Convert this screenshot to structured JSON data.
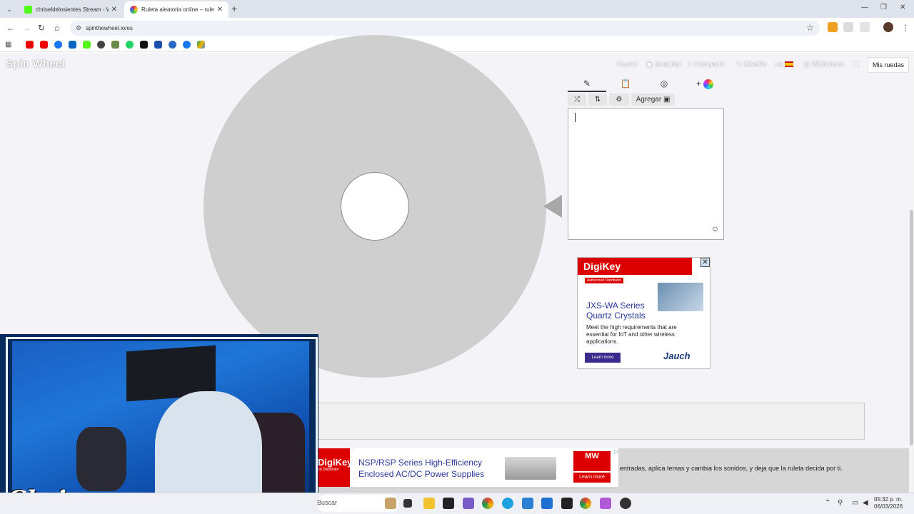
{
  "browser": {
    "tabs": [
      {
        "title": "chriseldelosientes Stream - Wat",
        "favicon_color": "#53fc18",
        "active": false
      },
      {
        "title": "Ruleta aleatoria online – ruleta",
        "favicon_color": "#f4a300",
        "active": true
      }
    ],
    "url_host": "spinthewheel.io",
    "url_path": "/es"
  },
  "page": {
    "logo": "Spin Wheel",
    "nav": {
      "new": "Nuevo",
      "save": "Guardar",
      "share": "Compartir",
      "design": "Diseño",
      "lang": "es",
      "library": "Biblioteca",
      "my_wheels": "Mis ruedas"
    },
    "editor": {
      "add_label": "Agregar",
      "entries_text": ""
    },
    "bottom_text": "entradas, aplica temas y cambia los sonidos, y deja que la ruleta decida por ti."
  },
  "ads": {
    "digikey": {
      "brand": "DigiKey",
      "tag": "Authorized Distributor",
      "headline": "JXS-WA Series Quartz Crystals",
      "body": "Meet the high requirements that are essential for IoT and other wireless applications.",
      "cta": "Learn more",
      "partner": "Jauch"
    },
    "banner": {
      "brand": "DigiKey",
      "tag": "ed Distributor",
      "line1": "NSP/RSP Series High-Efficiency",
      "line2": "Enclosed AC/DC Power Supplies",
      "partner": "MW",
      "cta": "Learn more"
    }
  },
  "overlay": {
    "name": "Chris"
  },
  "taskbar": {
    "search": "Buscar",
    "time": "05:32 p. m.",
    "date": "06/03/2026"
  },
  "colors": {
    "wheel": "#cfcfcf",
    "accent_red": "#dd0000",
    "cam_border": "#062b5c"
  }
}
